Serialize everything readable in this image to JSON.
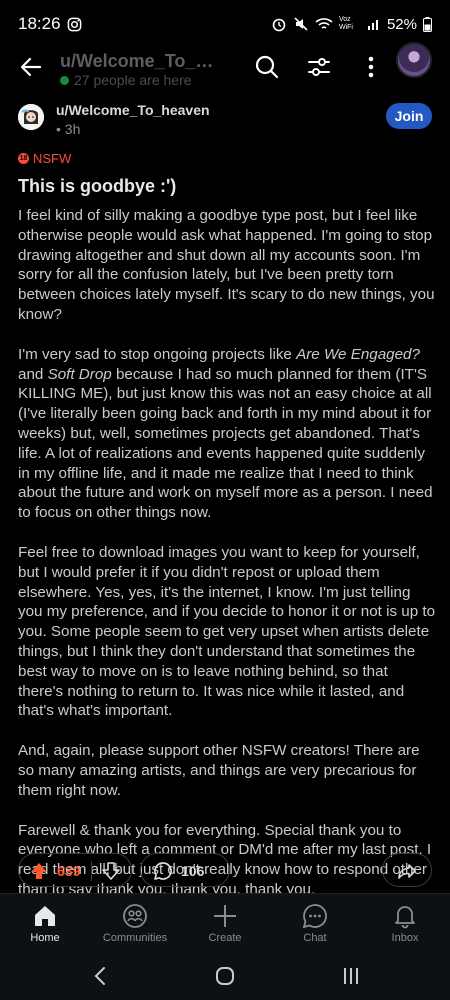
{
  "status_bar": {
    "time": "18:26",
    "battery": "52%",
    "network": "Voz WiFi"
  },
  "header": {
    "title": "u/Welcome_To_h...",
    "online": "27 people are here"
  },
  "post": {
    "subreddit": "u/Welcome_To_heaven",
    "time": "3h",
    "join_label": "Join",
    "nsfw_label": "NSFW",
    "title": "This is goodbye :')",
    "paragraphs": {
      "p1": "I feel kind of silly making a goodbye type post, but I feel like otherwise people would ask what happened. I'm going to stop drawing altogether and shut down all my accounts soon. I'm sorry for all the confusion lately, but I've been pretty torn between choices lately myself. It's scary to do new things, you know?",
      "p2_a": "I'm very sad to stop ongoing projects like ",
      "p2_em1": "Are We Engaged?",
      "p2_b": " and ",
      "p2_em2": "Soft Drop",
      "p2_c": " because I had so much planned for them (IT'S KILLING ME), but just know this was not an easy choice at all (I've literally been going back and forth in my mind about it for weeks) but, well, sometimes projects get abandoned. That's life. A lot of realizations and events happened quite suddenly in my offline life, and it made me realize that I need to think about the future and work on myself more as a person. I need to focus on other things now.",
      "p3": "Feel free to download images you want to keep for yourself, but I would prefer it if you didn't repost or upload them elsewhere. Yes, yes, it's the internet, I know. I'm just telling you my preference, and if you decide to honor it or not is up to you. Some people seem to get very upset when artists delete things, but I think they don't understand that sometimes the best way to move on is to leave nothing behind, so that there's nothing to return to. It was nice while it lasted, and that's what's important.",
      "p4": "And, again, please support other NSFW creators! There are so many amazing artists, and things are very precarious for them right now.",
      "p5": "Farewell & thank you for everything. Special thank you to everyone who left a comment or DM'd me after my last post. I read them all, but just don't really know how to respond other than to say thank you, thank you, thank you."
    },
    "votes": "639",
    "comments": "106"
  },
  "bottom_nav": {
    "home": "Home",
    "communities": "Communities",
    "create": "Create",
    "chat": "Chat",
    "inbox": "Inbox"
  },
  "colors": {
    "accent": "#2459c4",
    "upvote": "#ff5a2b",
    "nsfw": "#ff4b3a"
  }
}
